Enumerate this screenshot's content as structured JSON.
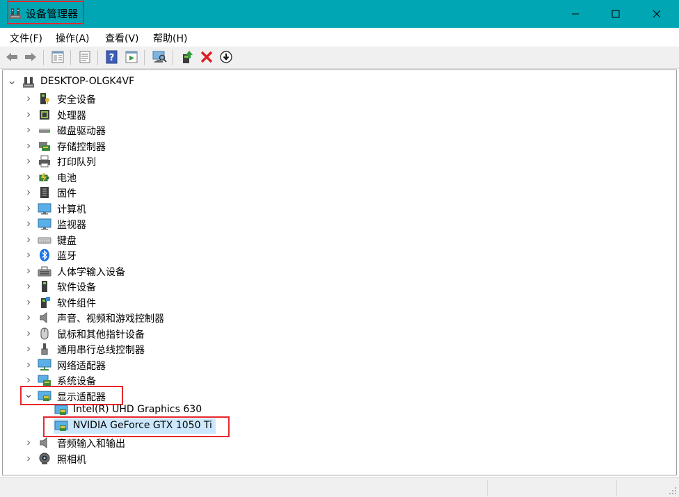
{
  "window": {
    "title": "设备管理器",
    "controls": {
      "minimize": "—",
      "maximize": "☐",
      "close": "✕"
    }
  },
  "menu": {
    "items": [
      "文件(F)",
      "操作(A)",
      "查看(V)",
      "帮助(H)"
    ]
  },
  "toolbar": {
    "buttons": [
      "back-arrow-icon",
      "forward-arrow-icon",
      "properties-pane-icon",
      "document-icon",
      "help-icon",
      "device-view-icon",
      "scan-hardware-icon",
      "update-driver-icon",
      "uninstall-icon",
      "install-download-icon"
    ]
  },
  "tree": {
    "root": "DESKTOP-OLGK4VF",
    "categories": [
      {
        "label": "安全设备",
        "icon": "security-device-icon"
      },
      {
        "label": "处理器",
        "icon": "processor-icon"
      },
      {
        "label": "磁盘驱动器",
        "icon": "disk-drive-icon"
      },
      {
        "label": "存储控制器",
        "icon": "storage-controller-icon"
      },
      {
        "label": "打印队列",
        "icon": "printer-icon"
      },
      {
        "label": "电池",
        "icon": "battery-icon"
      },
      {
        "label": "固件",
        "icon": "firmware-icon"
      },
      {
        "label": "计算机",
        "icon": "computer-icon"
      },
      {
        "label": "监视器",
        "icon": "monitor-icon"
      },
      {
        "label": "键盘",
        "icon": "keyboard-icon"
      },
      {
        "label": "蓝牙",
        "icon": "bluetooth-icon"
      },
      {
        "label": "人体学输入设备",
        "icon": "hid-icon"
      },
      {
        "label": "软件设备",
        "icon": "software-device-icon"
      },
      {
        "label": "软件组件",
        "icon": "software-component-icon"
      },
      {
        "label": "声音、视频和游戏控制器",
        "icon": "speaker-icon"
      },
      {
        "label": "鼠标和其他指针设备",
        "icon": "mouse-icon"
      },
      {
        "label": "通用串行总线控制器",
        "icon": "usb-icon"
      },
      {
        "label": "网络适配器",
        "icon": "network-adapter-icon"
      },
      {
        "label": "系统设备",
        "icon": "system-device-icon"
      },
      {
        "label": "显示适配器",
        "icon": "display-adapter-icon"
      },
      {
        "label": "音频输入和输出",
        "icon": "audio-io-icon"
      },
      {
        "label": "照相机",
        "icon": "camera-icon"
      }
    ],
    "display_adapters": {
      "children": [
        "Intel(R) UHD Graphics 630",
        "NVIDIA GeForce GTX 1050 Ti"
      ]
    }
  },
  "colors": {
    "titlebar": "#00a6b4",
    "selection": "#cce8ff",
    "highlight_box": "#e8262c"
  }
}
